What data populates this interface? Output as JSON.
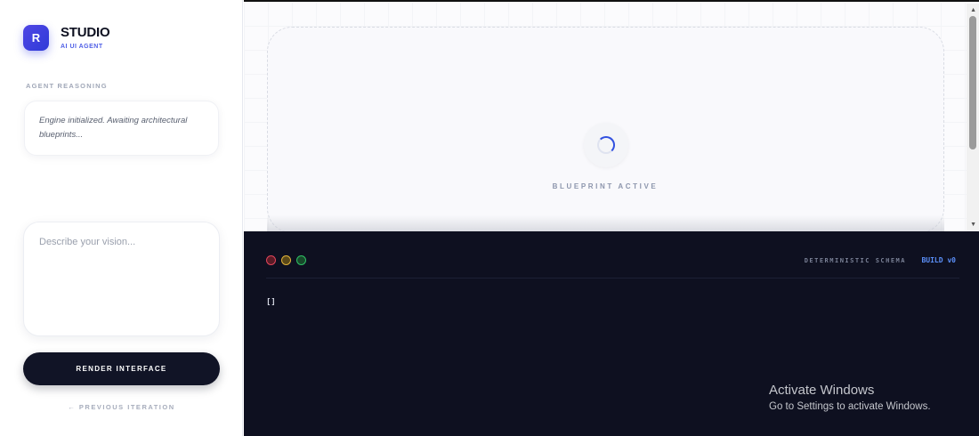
{
  "brand": {
    "logo_letter": "R",
    "title": "STUDIO",
    "subtitle": "AI UI AGENT"
  },
  "sidebar": {
    "reasoning_label": "AGENT REASONING",
    "reasoning_text": "Engine initialized. Awaiting architectural blueprints...",
    "vision_placeholder": "Describe your vision...",
    "vision_value": "",
    "render_button": "RENDER INTERFACE",
    "previous_link": "← PREVIOUS ITERATION"
  },
  "canvas": {
    "status_label": "BLUEPRINT ACTIVE",
    "spinner_icon": "loading-spinner-icon"
  },
  "console": {
    "schema_label": "DETERMINISTIC SCHEMA",
    "build_label": "BUILD v0",
    "output": "[]"
  },
  "os_overlay": {
    "title": "Activate Windows",
    "subtitle": "Go to Settings to activate Windows."
  },
  "colors": {
    "accent": "#4f46e5",
    "console_bg": "#0e1020",
    "build_label": "#5b8ff9"
  }
}
